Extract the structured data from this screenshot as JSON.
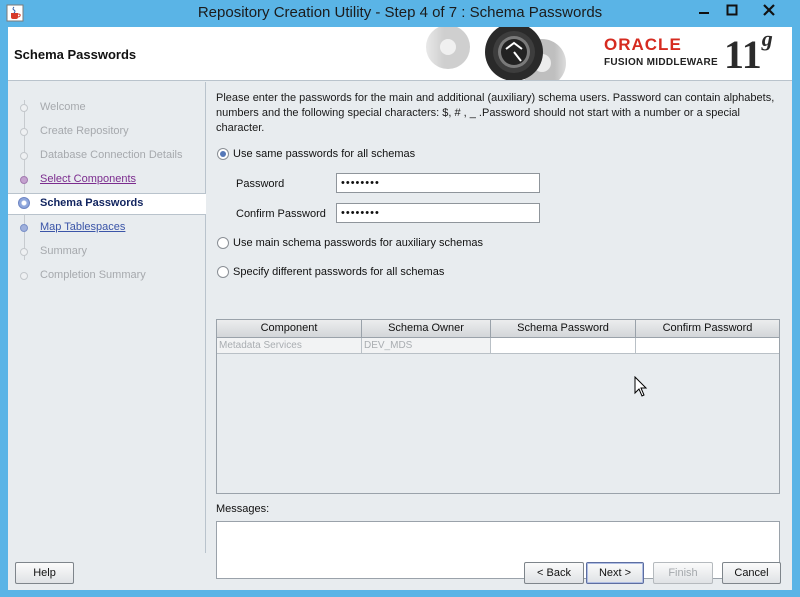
{
  "window": {
    "title": "Repository Creation Utility - Step 4 of 7 : Schema Passwords",
    "icons": {
      "app": "java-cup-icon",
      "minimize": "minimize-icon",
      "maximize": "maximize-icon",
      "close": "close-icon"
    }
  },
  "header": {
    "page_title": "Schema Passwords",
    "brand": "ORACLE",
    "product": "FUSION MIDDLEWARE",
    "version_number": "11",
    "version_letter": "g",
    "brand_color": "#d62b20"
  },
  "nav": {
    "items": [
      {
        "label": "Welcome",
        "state": "done"
      },
      {
        "label": "Create Repository",
        "state": "done"
      },
      {
        "label": "Database Connection Details",
        "state": "done"
      },
      {
        "label": "Select Components",
        "state": "visited"
      },
      {
        "label": "Schema Passwords",
        "state": "current"
      },
      {
        "label": "Map Tablespaces",
        "state": "visited"
      },
      {
        "label": "Summary",
        "state": "pending"
      },
      {
        "label": "Completion Summary",
        "state": "pending"
      }
    ]
  },
  "main": {
    "intro_line1": "Please enter the passwords for the main and additional (auxiliary) schema users. Password can contain alphabets,",
    "intro_line2": "numbers and the following special characters: $, # , _ .Password should not start with a number or a special",
    "intro_line3": "character.",
    "options": {
      "same": "Use same passwords for all schemas",
      "main_aux": "Use main schema passwords for auxiliary schemas",
      "different": "Specify different passwords for all schemas",
      "selected": "same"
    },
    "password_label": "Password",
    "password_value": "••••••••",
    "confirm_label": "Confirm Password",
    "confirm_value": "••••••••",
    "table": {
      "columns": [
        "Component",
        "Schema Owner",
        "Schema Password",
        "Confirm Password"
      ],
      "rows": [
        {
          "component": "Metadata Services",
          "owner": "DEV_MDS",
          "password": "",
          "confirm": ""
        }
      ]
    },
    "messages_label": "Messages:",
    "messages_text": ""
  },
  "footer": {
    "help": "Help",
    "back": "< Back",
    "next": "Next >",
    "finish": "Finish",
    "cancel": "Cancel"
  }
}
